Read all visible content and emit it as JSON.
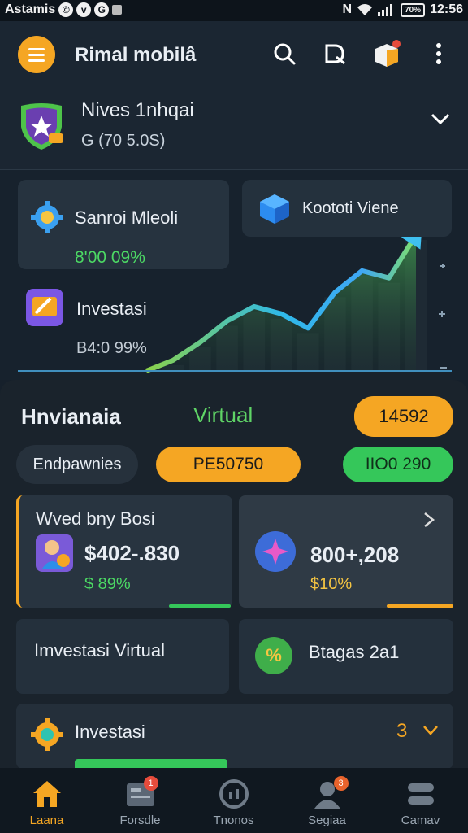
{
  "status_bar": {
    "carrier": "Astamis",
    "time": "12:56",
    "battery": "70%"
  },
  "header": {
    "title": "Rimal mobilâ"
  },
  "profile": {
    "name": "Nives 1nhqai",
    "id": "G (70 5.0S)"
  },
  "cards": [
    {
      "label": "Sanroi Mleoli",
      "value": "8'00 09%",
      "icon": "gear-icon"
    },
    {
      "label": "Koototi Viene",
      "icon": "cube-icon"
    },
    {
      "label": "Investasi",
      "value": "B4:0 99%",
      "icon": "wallet-icon"
    }
  ],
  "chart_data": {
    "type": "line",
    "x": [
      0,
      1,
      2,
      3,
      4,
      5,
      6,
      7,
      8,
      9,
      10
    ],
    "series": [
      {
        "values": [
          0,
          3,
          8,
          14,
          18,
          16,
          12,
          22,
          28,
          26,
          38
        ]
      }
    ],
    "grid": false,
    "legend": "none"
  },
  "panel": {
    "tab_left": "Hnvianaia",
    "tab_mid": "Virtual",
    "points": "14592",
    "filter_label": "Endpawnies",
    "pill_orange": "PE50750",
    "pill_green": "IIO0 290"
  },
  "tiles": [
    {
      "title": "Wved bny Bosi",
      "value": "$402-.830",
      "change": "$ 89%",
      "progress": 0.3
    },
    {
      "value": "800+,208",
      "change": "$10%",
      "progress": 0.3
    },
    {
      "title": "Imvestasi Virtual"
    },
    {
      "title": "Btagas 2a1"
    }
  ],
  "invest_row": {
    "title": "Investasi",
    "count": "3"
  },
  "bottom_nav": [
    {
      "label": "Laana",
      "icon": "home-icon",
      "active": true
    },
    {
      "label": "Forsdle",
      "icon": "portfolio-icon",
      "badge": "1"
    },
    {
      "label": "Tnonos",
      "icon": "clock-icon"
    },
    {
      "label": "Segiaa",
      "icon": "profile-icon",
      "badge": "3"
    },
    {
      "label": "Camav",
      "icon": "stack-icon"
    }
  ],
  "colors": {
    "accent_orange": "#f5a623",
    "accent_green": "#35c75a",
    "chart_line": "#39a9f0"
  }
}
